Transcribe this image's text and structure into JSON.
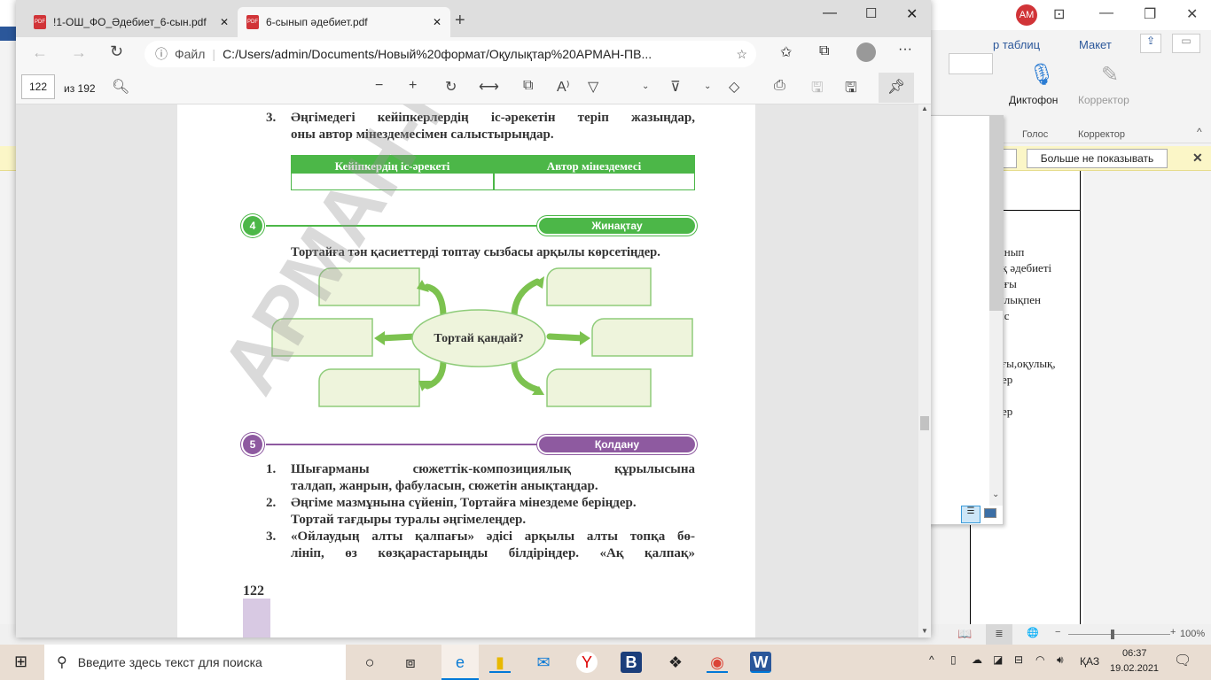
{
  "word": {
    "avatar": "AM",
    "ribbon_tabs": [
      "р таблиц",
      "Макет"
    ],
    "dictation_label": "Диктофон",
    "editor_label": "Корректор",
    "group_voice": "Голос",
    "group_editor": "Корректор",
    "message_button": "Больше не показывать",
    "doc_lines": [
      "ынып",
      "ақ әдебиеті",
      "ығы",
      "",
      "ылықпен",
      "ыс",
      "",
      "",
      "ағы,оқулық,",
      "кер",
      "",
      "кер"
    ],
    "zoom": "100%"
  },
  "edge": {
    "tabs": [
      {
        "label": "!1-ОШ_ФО_Әдебиет_6-сын.pdf",
        "active": false
      },
      {
        "label": "6-сынып әдебиет.pdf",
        "active": true
      }
    ],
    "address_prefix": "Файл",
    "address": "C:/Users/admin/Documents/Новый%20формат/Оқулықтар%20АРМАН-ПВ...",
    "page_number": "122",
    "page_total": "из 192"
  },
  "pdf": {
    "watermark": "АРМАН-ПВ 6",
    "task3_num": "3.",
    "task3_line1": "Әңгімедегі кейіпкерлердің іс-әрекетін теріп жазыңдар,",
    "task3_line2": "оны автор мінездемесімен салыстырыңдар.",
    "table_headers": [
      "Кейіпкердің іс-әрекеті",
      "Автор мінездемесі"
    ],
    "section4": {
      "num": "4",
      "label": "Жинақтау",
      "color": "#4cb748"
    },
    "section4_text": "Тортайға тән қасиеттерді топтау сызбасы арқылы көрсетіңдер.",
    "diagram_center": "Тортай қандай?",
    "section5": {
      "num": "5",
      "label": "Қолдану",
      "color": "#8e5aa0"
    },
    "items": [
      {
        "num": "1.",
        "l1": "Шығарманы сюжеттік-композициялық құрылысына",
        "l2": "талдап, жанрын, фабуласын, сюжетін анықтаңдар."
      },
      {
        "num": "2.",
        "l1": "Әңгіме мазмұнына сүйеніп, Тортайға мінездеме беріңдер.",
        "l2": "Тортай тағдыры туралы әңгімелеңдер."
      },
      {
        "num": "3.",
        "l1": "«Ойлаудың алты қалпағы» әдісі арқылы алты топқа бө-",
        "l2": "лініп, өз көзқарастарыңды білдіріңдер. «Ақ қалпақ»"
      }
    ],
    "page_num": "122"
  },
  "taskbar": {
    "search_placeholder": "Введите здесь текст для поиска",
    "lang": "ҚАЗ",
    "time": "06:37",
    "date": "19.02.2021"
  }
}
